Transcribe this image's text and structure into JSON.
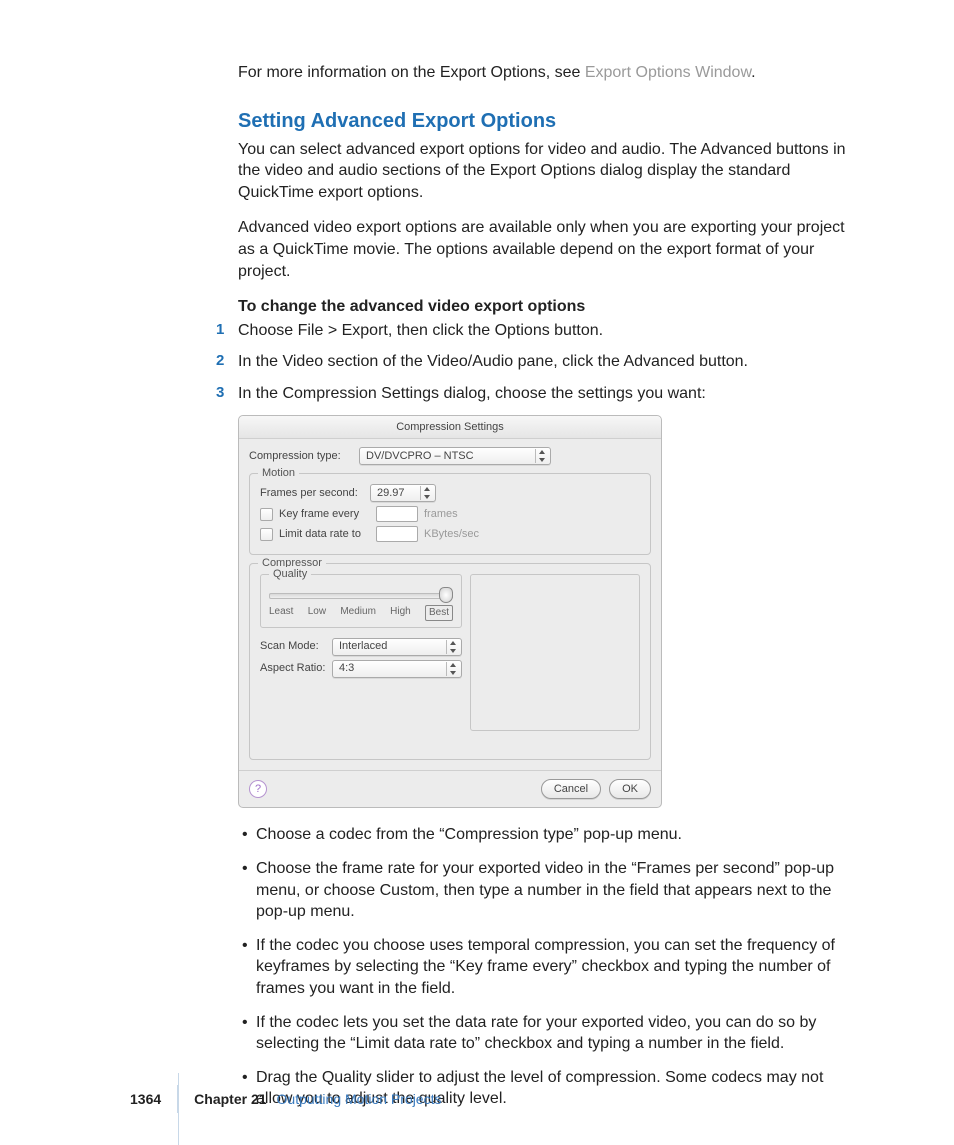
{
  "intro": {
    "pre": "For more information on the Export Options, see ",
    "link": "Export Options Window",
    "post": "."
  },
  "heading": "Setting Advanced Export Options",
  "para1": "You can select advanced export options for video and audio. The Advanced buttons in the video and audio sections of the Export Options dialog display the standard QuickTime export options.",
  "para2": "Advanced video export options are available only when you are exporting your project as a QuickTime movie. The options available depend on the export format of your project.",
  "task_head": "To change the advanced video export options",
  "steps": [
    "Choose File > Export, then click the Options button.",
    "In the Video section of the Video/Audio pane, click the Advanced button.",
    "In the Compression Settings dialog, choose the settings you want:"
  ],
  "dialog": {
    "title": "Compression Settings",
    "compression_type_label": "Compression type:",
    "compression_type_value": "DV/DVCPRO – NTSC",
    "motion_legend": "Motion",
    "fps_label": "Frames per second:",
    "fps_value": "29.97",
    "keyframe_chk": "Key frame every",
    "keyframe_unit": "frames",
    "limit_chk": "Limit data rate to",
    "limit_unit": "KBytes/sec",
    "compressor_legend": "Compressor",
    "quality_legend": "Quality",
    "quality_labels": [
      "Least",
      "Low",
      "Medium",
      "High",
      "Best"
    ],
    "scan_label": "Scan Mode:",
    "scan_value": "Interlaced",
    "aspect_label": "Aspect Ratio:",
    "aspect_value": "4:3",
    "help": "?",
    "cancel": "Cancel",
    "ok": "OK"
  },
  "bullets": [
    "Choose a codec from the “Compression type” pop-up menu.",
    "Choose the frame rate for your exported video in the “Frames per second” pop-up menu, or choose Custom, then type a number in the field that appears next to the pop-up menu.",
    "If the codec you choose uses temporal compression, you can set the frequency of keyframes by selecting the “Key frame every” checkbox and typing the number of frames you want in the field.",
    "If the codec lets you set the data rate for your exported video, you can do so by selecting the “Limit data rate to” checkbox and typing a number in the field.",
    "Drag the Quality slider to adjust the level of compression. Some codecs may not allow you to adjust the quality level."
  ],
  "footer": {
    "page": "1364",
    "chapter_label": "Chapter 21",
    "chapter_title": "Outputting Motion Projects"
  }
}
